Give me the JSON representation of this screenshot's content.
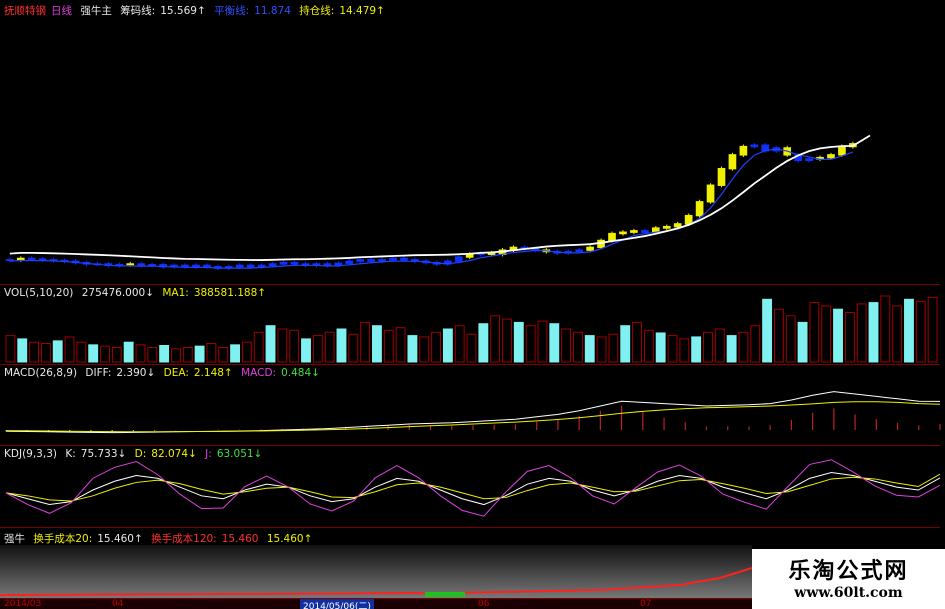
{
  "main": {
    "legend": {
      "indicator": "抚顺特钢",
      "period": "日线",
      "item1": "强牛主",
      "item2_label": "筹码线:",
      "item2_value": "15.569↑",
      "item3_label": "平衡线:",
      "item3_value": "11.874",
      "item4_label": "持仓线:",
      "item4_value": "14.479↑"
    }
  },
  "vol": {
    "legend": {
      "name": "VOL(5,10,20)",
      "value": "275476.000↓",
      "ma_label": "MA1:",
      "ma_value": "388581.188↑"
    }
  },
  "macd": {
    "legend": {
      "name": "MACD(26,8,9)",
      "diff_label": "DIFF:",
      "diff_value": "2.390↓",
      "dea_label": "DEA:",
      "dea_value": "2.148↑",
      "macd_label": "MACD:",
      "macd_value": "0.484↓"
    }
  },
  "kdj": {
    "legend": {
      "name": "KDJ(9,3,3)",
      "k_label": "K:",
      "k_value": "75.733↓",
      "d_label": "D:",
      "d_value": "82.074↓",
      "j_label": "J:",
      "j_value": "63.051↓"
    }
  },
  "cost": {
    "legend": {
      "name": "强牛",
      "a_label": "换手成本20:",
      "a_value": "15.460↑",
      "b_label": "换手成本120:",
      "b_value": "15.460",
      "c_value": "15.460↑"
    }
  },
  "dates": {
    "d1": "2014/03",
    "d2": "04",
    "d3": "2014/05/06(二)",
    "d4": "06",
    "d5": "07"
  },
  "watermark": {
    "title": "乐淘公式网",
    "url": "www.60lt.com"
  },
  "colors": {
    "up": "#f0f000",
    "down": "#1030ff",
    "vol_up": "#a00000",
    "vol_down": "#80f0f0",
    "ma_white": "#ffffff",
    "kdj_k": "#ffffff",
    "kdj_d": "#f0f000",
    "kdj_j": "#e040e0",
    "separator": "#7a0000"
  },
  "chart_data": [
    {
      "type": "candlestick",
      "panel": "main",
      "closes": [
        8.6,
        8.7,
        8.65,
        8.6,
        8.55,
        8.5,
        8.4,
        8.3,
        8.3,
        8.2,
        8.25,
        8.3,
        8.2,
        8.25,
        8.1,
        8.2,
        8.1,
        8.2,
        8.1,
        8.0,
        8.1,
        8.2,
        8.1,
        8.2,
        8.3,
        8.4,
        8.3,
        8.2,
        8.3,
        8.2,
        8.35,
        8.5,
        8.6,
        8.5,
        8.6,
        8.7,
        8.6,
        8.5,
        8.4,
        8.3,
        8.5,
        8.8,
        9.0,
        9.1,
        9.0,
        9.3,
        9.5,
        9.4,
        9.3,
        9.2,
        9.1,
        9.2,
        9.3,
        9.5,
        10.0,
        10.5,
        10.6,
        10.7,
        10.6,
        10.9,
        11.0,
        11.2,
        11.8,
        12.8,
        14.0,
        15.2,
        16.2,
        16.8,
        16.9,
        16.5,
        16.7,
        16.2,
        15.8,
        15.9,
        16.0,
        16.2,
        16.8,
        17.0
      ],
      "up_days": [
        1,
        11,
        42,
        44,
        45,
        46,
        49,
        53,
        54,
        55,
        56,
        57,
        59,
        60,
        61,
        62,
        63,
        64,
        65,
        66,
        67,
        71,
        74,
        75,
        76,
        77
      ],
      "ma_white": "ascending line following the trend, from about 9.0 to about 17.5",
      "ma_blue": "short moving average tracking price"
    },
    {
      "type": "bar",
      "panel": "volume",
      "values": [
        40,
        35,
        30,
        28,
        32,
        38,
        30,
        26,
        24,
        22,
        30,
        26,
        22,
        25,
        20,
        22,
        24,
        28,
        22,
        26,
        30,
        45,
        55,
        50,
        48,
        35,
        40,
        45,
        50,
        42,
        60,
        55,
        48,
        52,
        40,
        38,
        45,
        50,
        55,
        42,
        58,
        70,
        65,
        60,
        55,
        62,
        58,
        50,
        45,
        40,
        38,
        42,
        55,
        60,
        48,
        44,
        40,
        35,
        38,
        45,
        50,
        40,
        45,
        55,
        95,
        80,
        70,
        60,
        90,
        85,
        80,
        75,
        88,
        90,
        100,
        85,
        95,
        92,
        98
      ]
    },
    {
      "type": "line",
      "panel": "macd",
      "series": [
        {
          "name": "DIFF",
          "values": [
            -0.1,
            -0.12,
            -0.15,
            -0.18,
            -0.2,
            -0.22,
            -0.2,
            -0.18,
            -0.15,
            -0.12,
            -0.1,
            -0.08,
            -0.05,
            0.0,
            0.05,
            0.1,
            0.2,
            0.3,
            0.4,
            0.5,
            0.55,
            0.6,
            0.7,
            0.8,
            0.9,
            1.1,
            1.3,
            1.6,
            2.0,
            2.4,
            2.3,
            2.2,
            2.1,
            2.0,
            2.05,
            2.1,
            2.2,
            2.5,
            2.9,
            3.2,
            3.0,
            2.8,
            2.6,
            2.4,
            2.39
          ]
        },
        {
          "name": "DEA",
          "values": [
            -0.05,
            -0.06,
            -0.08,
            -0.1,
            -0.12,
            -0.14,
            -0.15,
            -0.15,
            -0.14,
            -0.13,
            -0.12,
            -0.1,
            -0.08,
            -0.05,
            -0.02,
            0.02,
            0.06,
            0.12,
            0.2,
            0.28,
            0.35,
            0.42,
            0.5,
            0.58,
            0.66,
            0.76,
            0.88,
            1.02,
            1.2,
            1.4,
            1.55,
            1.68,
            1.78,
            1.85,
            1.9,
            1.95,
            2.0,
            2.08,
            2.18,
            2.3,
            2.35,
            2.35,
            2.3,
            2.2,
            2.148
          ]
        }
      ]
    },
    {
      "type": "line",
      "panel": "kdj",
      "series": [
        {
          "name": "K",
          "values": [
            50,
            40,
            30,
            35,
            55,
            70,
            80,
            75,
            60,
            45,
            40,
            55,
            65,
            60,
            45,
            35,
            40,
            60,
            75,
            70,
            55,
            40,
            30,
            45,
            65,
            75,
            70,
            55,
            45,
            55,
            70,
            80,
            75,
            60,
            50,
            40,
            55,
            75,
            85,
            80,
            70,
            60,
            55,
            75.7
          ]
        },
        {
          "name": "D",
          "values": [
            50,
            45,
            38,
            36,
            45,
            58,
            68,
            72,
            66,
            56,
            48,
            52,
            58,
            60,
            52,
            43,
            42,
            52,
            64,
            67,
            60,
            50,
            40,
            42,
            54,
            64,
            67,
            60,
            52,
            53,
            62,
            71,
            73,
            66,
            58,
            49,
            52,
            63,
            74,
            77,
            74,
            67,
            61,
            82.1
          ]
        },
        {
          "name": "J",
          "values": [
            50,
            30,
            15,
            33,
            75,
            94,
            104,
            81,
            48,
            23,
            24,
            61,
            79,
            60,
            31,
            19,
            36,
            76,
            97,
            76,
            45,
            20,
            10,
            51,
            87,
            97,
            76,
            45,
            31,
            59,
            86,
            98,
            79,
            48,
            34,
            22,
            61,
            99,
            107,
            86,
            62,
            46,
            43,
            63.1
          ]
        }
      ]
    }
  ]
}
